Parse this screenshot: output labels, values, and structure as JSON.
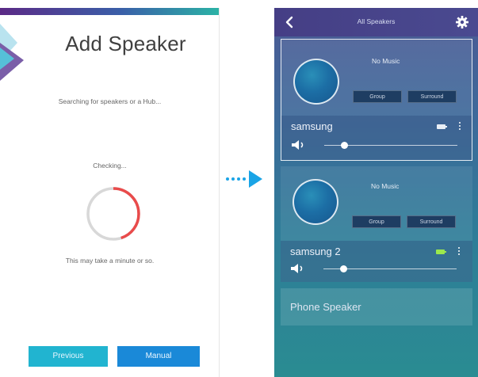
{
  "left_screen": {
    "title": "Add Speaker",
    "searching_text": "Searching for speakers or a Hub...",
    "checking_text": "Checking...",
    "progress_fraction": 0.45,
    "wait_text": "This may take a minute or so.",
    "previous_label": "Previous",
    "manual_label": "Manual"
  },
  "right_screen": {
    "header_title": "All Speakers",
    "speakers": [
      {
        "status": "No Music",
        "group_label": "Group",
        "surround_label": "Surround",
        "name": "samsung",
        "volume_fraction": 0.15,
        "battery_color": "#e8eef6"
      },
      {
        "status": "No Music",
        "group_label": "Group",
        "surround_label": "Surround",
        "name": "samsung 2",
        "volume_fraction": 0.15,
        "battery_color": "#9be84d"
      }
    ],
    "phone_speaker_label": "Phone Speaker"
  },
  "colors": {
    "previous_button": "#21b4d0",
    "manual_button": "#1a89d8",
    "spinner_active": "#e94b4b",
    "spinner_track": "#d8d8d8",
    "arrow": "#1aa4e6"
  },
  "icons": [
    "logo-icon",
    "back-icon",
    "gear-icon",
    "volume-icon",
    "battery-icon",
    "more-icon",
    "arrow-icon"
  ]
}
